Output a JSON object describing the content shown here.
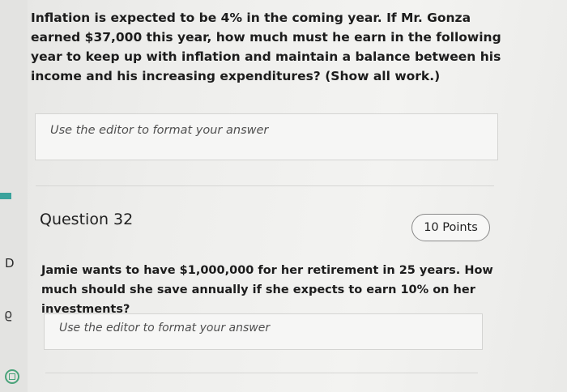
{
  "question_31": {
    "text": "Inflation is expected to be 4% in the coming year. If Mr. Gonza earned $37,000 this year, how much must he earn in the following year to keep up with inflation and maintain a balance between his income and his increasing expenditures? (Show all work.)",
    "answer_placeholder": "Use the editor to format your answer"
  },
  "question_32": {
    "title": "Question 32",
    "points": "10 Points",
    "text": "Jamie wants to have $1,000,000 for her retirement in 25 years. How much should she save annually if she expects to earn 10% on her investments?",
    "answer_placeholder": "Use the editor to format your answer"
  },
  "left_rail": {
    "letter": "D",
    "glyph": "ϱ",
    "accent_color": "#3aa39c",
    "icon": "editor-icon"
  }
}
